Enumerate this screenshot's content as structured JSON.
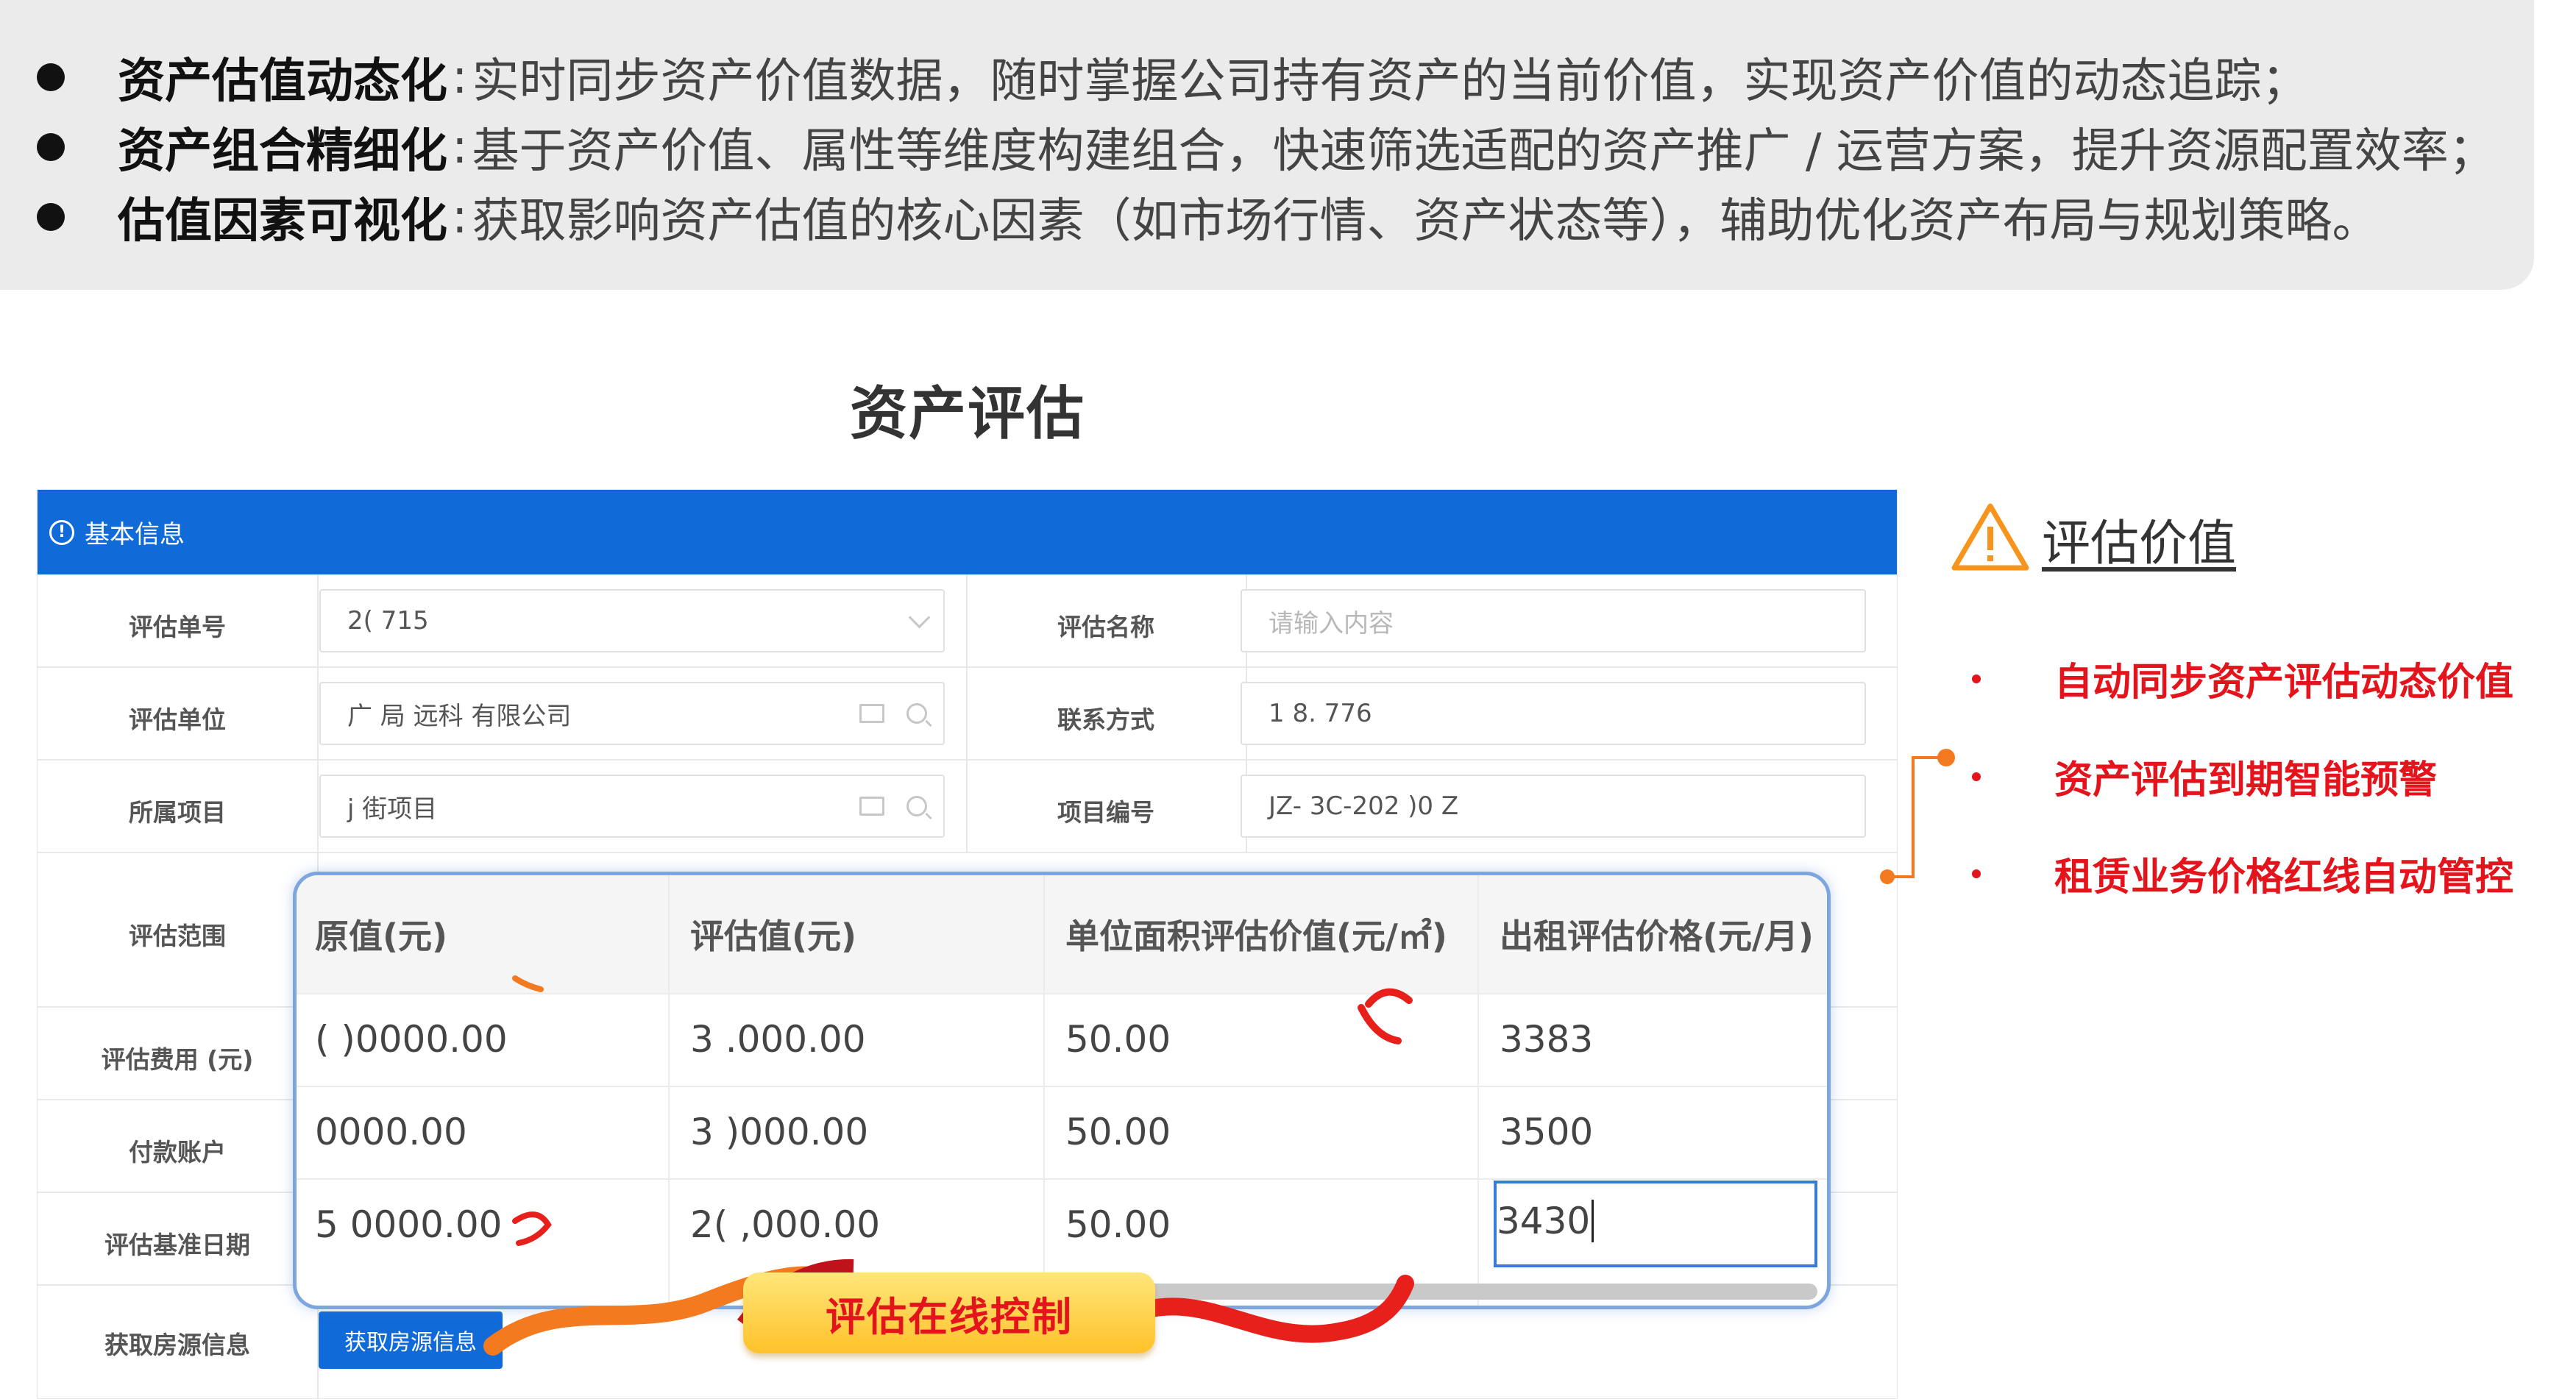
{
  "summary": {
    "items": [
      {
        "title": "资产估值动态化",
        "sep": ":",
        "text": "实时同步资产价值数据，随时掌握公司持有资产的当前价值，实现资产价值的动态追踪；"
      },
      {
        "title": "资产组合精细化",
        "sep": ":",
        "text": "基于资产价值、属性等维度构建组合，快速筛选适配的资产推广 / 运营方案，提升资源配置效率；"
      },
      {
        "title": "估值因素可视化",
        "sep": ":",
        "text": "获取影响资产估值的核心因素（如市场行情、资产状态等），辅助优化资产布局与规划策略。"
      }
    ]
  },
  "section_title": "资产评估",
  "form": {
    "header": "基本信息",
    "fields": {
      "eval_no": {
        "label": "评估单号",
        "value": "2(   715"
      },
      "eval_name": {
        "label": "评估名称",
        "placeholder": "请输入内容"
      },
      "eval_unit": {
        "label": "评估单位",
        "value": "广     局     远科    有限公司"
      },
      "contact": {
        "label": "联系方式",
        "value": "1     8.   776"
      },
      "project": {
        "label": "所属项目",
        "value": "j     街项目"
      },
      "project_no": {
        "label": "项目编号",
        "value": "JZ-    3C-202    )0    Z"
      },
      "scope": {
        "label": "评估范围"
      },
      "fee": {
        "label": "评估费用 (元)"
      },
      "account": {
        "label": "付款账户"
      },
      "base_date": {
        "label": "评估基准日期"
      },
      "fetch": {
        "label": "获取房源信息",
        "button": "获取房源信息"
      }
    }
  },
  "overlay_table": {
    "columns": [
      "原值(元)",
      "评估值(元)",
      "单位面积评估价值(元/㎡)",
      "出租评估价格(元/月)"
    ],
    "rows": [
      [
        "(   )0000.00",
        "3    .000.00",
        "50.00",
        "3383"
      ],
      [
        "     0000.00",
        "3     )000.00",
        "50.00",
        "3500"
      ],
      [
        "5    0000.00",
        "2(    ,000.00",
        "50.00",
        "3430"
      ]
    ]
  },
  "banner": "评估在线控制",
  "right_panel": {
    "title": "评估价值",
    "features": [
      "自动同步资产评估动态价值",
      "资产评估到期智能预警",
      "租赁业务价格红线自动管控"
    ]
  },
  "colors": {
    "primary_blue": "#106ad8",
    "accent_red": "#e4141c",
    "accent_orange": "#f7941d",
    "banner_yellow": "#ffc22a"
  }
}
